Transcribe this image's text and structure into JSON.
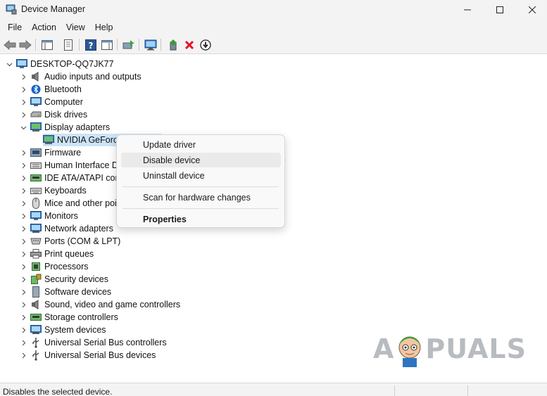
{
  "window": {
    "title": "Device Manager"
  },
  "menu": [
    "File",
    "Action",
    "View",
    "Help"
  ],
  "tree": {
    "root": "DESKTOP-QQ7JK77",
    "items": [
      {
        "label": "Audio inputs and outputs",
        "icon": "speaker-icon"
      },
      {
        "label": "Bluetooth",
        "icon": "bluetooth-icon"
      },
      {
        "label": "Computer",
        "icon": "computer-icon"
      },
      {
        "label": "Disk drives",
        "icon": "disk-drive-icon"
      },
      {
        "label": "Display adapters",
        "icon": "display-adapter-icon",
        "expanded": true
      },
      {
        "label": "NVIDIA GeForce",
        "icon": "display-adapter-icon",
        "child": true
      },
      {
        "label": "Firmware",
        "icon": "firmware-icon"
      },
      {
        "label": "Human Interface D",
        "icon": "hid-icon"
      },
      {
        "label": "IDE ATA/ATAPI cont",
        "icon": "ide-controller-icon"
      },
      {
        "label": "Keyboards",
        "icon": "keyboard-icon"
      },
      {
        "label": "Mice and other poi",
        "icon": "mouse-icon"
      },
      {
        "label": "Monitors",
        "icon": "monitor-icon"
      },
      {
        "label": "Network adapters",
        "icon": "network-adapter-icon"
      },
      {
        "label": "Ports (COM & LPT)",
        "icon": "port-icon"
      },
      {
        "label": "Print queues",
        "icon": "printer-icon"
      },
      {
        "label": "Processors",
        "icon": "processor-icon"
      },
      {
        "label": "Security devices",
        "icon": "security-device-icon"
      },
      {
        "label": "Software devices",
        "icon": "software-device-icon"
      },
      {
        "label": "Sound, video and game controllers",
        "icon": "sound-icon"
      },
      {
        "label": "Storage controllers",
        "icon": "storage-controller-icon"
      },
      {
        "label": "System devices",
        "icon": "system-device-icon"
      },
      {
        "label": "Universal Serial Bus controllers",
        "icon": "usb-icon"
      },
      {
        "label": "Universal Serial Bus devices",
        "icon": "usb-icon"
      }
    ]
  },
  "context_menu": {
    "update_driver": "Update driver",
    "disable_device": "Disable device",
    "uninstall_device": "Uninstall device",
    "scan_hardware": "Scan for hardware changes",
    "properties": "Properties"
  },
  "status": {
    "text": "Disables the selected device."
  },
  "watermark": {
    "left": "A",
    "right": "PUALS"
  },
  "colors": {
    "selection": "#cce4f7",
    "accent": "#0067c0",
    "delete_red": "#e81123"
  }
}
